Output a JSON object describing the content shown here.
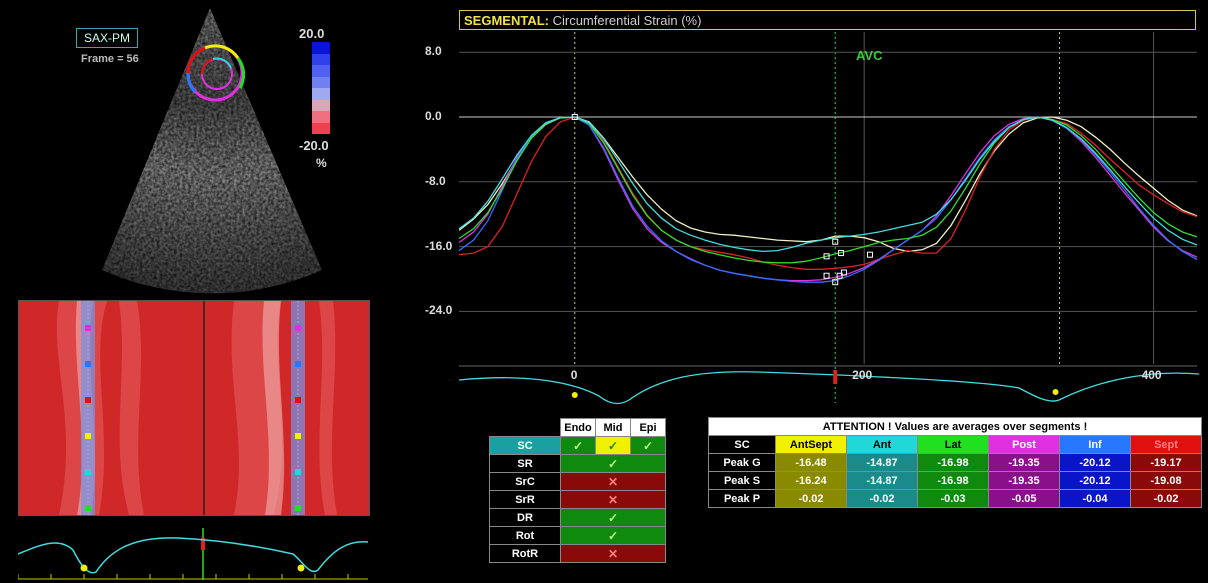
{
  "echo": {
    "view": "SAX-PM",
    "frame": "Frame = 56",
    "scale_max": "20.0",
    "scale_min": "-20.0",
    "scale_unit": "%",
    "scale_colors": [
      "#0a14d8",
      "#3040e8",
      "#5060f0",
      "#7080f0",
      "#a0a8f0",
      "#d8a8b8",
      "#f07080",
      "#f04050"
    ]
  },
  "plot": {
    "title_prefix": "SEGMENTAL:",
    "title_rest": " Circumferential Strain (%)",
    "y_ticks": [
      "8.0",
      "0.0",
      "-8.0",
      "-16.0",
      "-24.0"
    ],
    "x_ticks": [
      "0",
      "200",
      "400"
    ],
    "marker": "AVC"
  },
  "chart_data": {
    "type": "line",
    "title": "SEGMENTAL: Circumferential Strain (%)",
    "xlabel": "",
    "ylabel": "",
    "ylim": [
      -30.5,
      10.5
    ],
    "xlim": [
      -80,
      430
    ],
    "x_ticks": [
      0,
      200,
      400
    ],
    "y_ticks": [
      8,
      0,
      -8,
      -16,
      -24
    ],
    "grid": true,
    "annotations": [
      {
        "text": "AVC",
        "x": 180
      }
    ],
    "x": [
      -80,
      -70,
      -60,
      -50,
      -40,
      -30,
      -20,
      -10,
      0,
      10,
      20,
      30,
      40,
      50,
      60,
      70,
      80,
      90,
      100,
      110,
      120,
      130,
      140,
      150,
      160,
      170,
      180,
      190,
      200,
      210,
      220,
      230,
      240,
      250,
      260,
      270,
      280,
      290,
      300,
      310,
      320,
      330,
      340,
      350,
      360,
      370,
      380,
      390,
      400,
      410,
      420,
      430
    ],
    "series": [
      {
        "color": "#f0f0c0",
        "values": [
          -14.0,
          -12.6,
          -10.8,
          -8.2,
          -5.2,
          -2.6,
          -0.9,
          -0.1,
          0.0,
          -0.6,
          -2.6,
          -5.0,
          -7.4,
          -9.6,
          -11.4,
          -12.8,
          -13.7,
          -14.2,
          -14.5,
          -14.6,
          -14.8,
          -15.0,
          -15.2,
          -15.3,
          -15.4,
          -15.2,
          -14.7,
          -14.7,
          -14.9,
          -15.4,
          -16.2,
          -16.6,
          -16.4,
          -15.6,
          -13.4,
          -10.3,
          -7.0,
          -4.2,
          -2.1,
          -0.7,
          -0.1,
          0.0,
          -0.4,
          -1.2,
          -2.5,
          -4.0,
          -5.7,
          -7.3,
          -8.8,
          -10.3,
          -11.5,
          -12.2
        ]
      },
      {
        "color": "#dd2020",
        "values": [
          -17.0,
          -16.8,
          -16.0,
          -13.5,
          -9.5,
          -5.5,
          -2.4,
          -0.6,
          0.0,
          -0.8,
          -3.0,
          -6.2,
          -9.4,
          -12.1,
          -14.0,
          -15.2,
          -16.0,
          -16.4,
          -16.7,
          -17.0,
          -17.4,
          -17.9,
          -18.3,
          -18.6,
          -18.8,
          -18.8,
          -18.7,
          -18.5,
          -18.2,
          -17.6,
          -17.0,
          -16.5,
          -16.8,
          -16.8,
          -15.0,
          -11.5,
          -7.4,
          -4.0,
          -1.6,
          -0.4,
          0.0,
          -0.3,
          -0.8,
          -2.0,
          -3.5,
          -5.2,
          -6.8,
          -8.4,
          -9.6,
          -10.7,
          -11.7,
          -12.3
        ]
      },
      {
        "color": "#e030e0",
        "values": [
          -15.5,
          -14.2,
          -12.0,
          -8.5,
          -5.0,
          -2.3,
          -0.7,
          -0.1,
          0.0,
          -1.0,
          -4.0,
          -7.8,
          -11.3,
          -13.8,
          -15.5,
          -16.6,
          -17.5,
          -18.3,
          -18.9,
          -19.3,
          -19.6,
          -19.9,
          -20.1,
          -20.2,
          -20.2,
          -20.1,
          -19.8,
          -19.3,
          -18.6,
          -17.6,
          -16.4,
          -15.2,
          -14.0,
          -12.2,
          -9.7,
          -7.0,
          -4.4,
          -2.3,
          -0.9,
          -0.2,
          0.0,
          -0.4,
          -1.4,
          -3.0,
          -5.0,
          -7.2,
          -9.4,
          -11.5,
          -13.6,
          -15.3,
          -16.5,
          -17.3
        ]
      },
      {
        "color": "#3070ff",
        "values": [
          -16.5,
          -15.2,
          -12.8,
          -9.0,
          -5.2,
          -2.4,
          -0.7,
          -0.1,
          0.0,
          -1.0,
          -3.8,
          -7.5,
          -11.0,
          -13.5,
          -15.3,
          -16.6,
          -17.6,
          -18.3,
          -18.9,
          -19.3,
          -19.6,
          -19.9,
          -20.1,
          -20.3,
          -20.4,
          -20.4,
          -20.2,
          -19.6,
          -18.8,
          -17.7,
          -16.4,
          -15.2,
          -14.0,
          -12.5,
          -10.2,
          -7.6,
          -5.0,
          -2.8,
          -1.2,
          -0.3,
          0.0,
          -0.4,
          -1.4,
          -2.8,
          -4.7,
          -6.8,
          -9.0,
          -11.3,
          -13.4,
          -15.2,
          -16.6,
          -17.6
        ]
      },
      {
        "color": "#30dd30",
        "values": [
          -15.0,
          -13.8,
          -11.8,
          -8.8,
          -5.4,
          -2.6,
          -0.8,
          -0.1,
          0.0,
          -0.8,
          -3.2,
          -6.4,
          -9.6,
          -12.2,
          -14.0,
          -15.2,
          -16.0,
          -16.6,
          -17.0,
          -17.4,
          -17.7,
          -17.9,
          -18.0,
          -18.0,
          -17.8,
          -17.4,
          -16.9,
          -16.5,
          -16.0,
          -15.5,
          -15.2,
          -15.0,
          -14.6,
          -13.6,
          -11.6,
          -8.8,
          -5.8,
          -3.2,
          -1.3,
          -0.3,
          0.0,
          -0.3,
          -1.0,
          -2.3,
          -4.0,
          -6.0,
          -8.0,
          -10.0,
          -11.8,
          -13.2,
          -14.2,
          -14.8
        ]
      },
      {
        "color": "#40dde0",
        "values": [
          -13.8,
          -12.5,
          -10.4,
          -7.6,
          -4.7,
          -2.3,
          -0.7,
          -0.1,
          0.0,
          -0.7,
          -2.7,
          -5.4,
          -8.2,
          -10.7,
          -12.5,
          -13.8,
          -14.6,
          -15.2,
          -15.7,
          -16.1,
          -16.4,
          -16.6,
          -16.5,
          -16.1,
          -15.6,
          -15.2,
          -14.9,
          -14.7,
          -14.5,
          -14.2,
          -13.8,
          -13.4,
          -13.0,
          -12.0,
          -10.2,
          -7.8,
          -5.2,
          -3.0,
          -1.3,
          -0.3,
          0.0,
          -0.4,
          -1.3,
          -2.7,
          -4.5,
          -6.5,
          -8.6,
          -10.6,
          -12.5,
          -14.0,
          -15.1,
          -15.8
        ]
      }
    ]
  },
  "left_table": {
    "headers": [
      "Endo",
      "Mid",
      "Epi"
    ],
    "rows": [
      {
        "label": "SC",
        "cells": [
          "check",
          "check",
          "check"
        ]
      },
      {
        "label": "SR",
        "cells": [
          "check"
        ]
      },
      {
        "label": "SrC",
        "cells": [
          "cross"
        ]
      },
      {
        "label": "SrR",
        "cells": [
          "cross"
        ]
      },
      {
        "label": "DR",
        "cells": [
          "check"
        ]
      },
      {
        "label": "Rot",
        "cells": [
          "check"
        ]
      },
      {
        "label": "RotR",
        "cells": [
          "cross"
        ]
      }
    ],
    "check_glyph": "✓",
    "cross_glyph": "✕"
  },
  "right_table": {
    "attention": "ATTENTION !  Values are averages over segments !",
    "corner": "SC",
    "columns": [
      {
        "name": "AntSept",
        "color": "#f0f000",
        "text": "#000",
        "cell": "#8a8a00"
      },
      {
        "name": "Ant",
        "color": "#20d8d8",
        "text": "#000",
        "cell": "#1a8a8a"
      },
      {
        "name": "Lat",
        "color": "#20e020",
        "text": "#000",
        "cell": "#0f8a0f"
      },
      {
        "name": "Post",
        "color": "#e030e0",
        "text": "#fff",
        "cell": "#8a108a"
      },
      {
        "name": "Inf",
        "color": "#2878ff",
        "text": "#fff",
        "cell": "#0a14c8"
      },
      {
        "name": "Sept",
        "color": "#e01010",
        "text": "#ff8080",
        "cell": "#8a0a0a"
      }
    ],
    "rows": [
      {
        "label": "Peak G",
        "values": [
          "-16.48",
          "-14.87",
          "-16.98",
          "-19.35",
          "-20.12",
          "-19.17"
        ]
      },
      {
        "label": "Peak S",
        "values": [
          "-16.24",
          "-14.87",
          "-16.98",
          "-19.35",
          "-20.12",
          "-19.08"
        ]
      },
      {
        "label": "Peak P",
        "values": [
          "-0.02",
          "-0.02",
          "-0.03",
          "-0.05",
          "-0.04",
          "-0.02"
        ]
      }
    ]
  }
}
